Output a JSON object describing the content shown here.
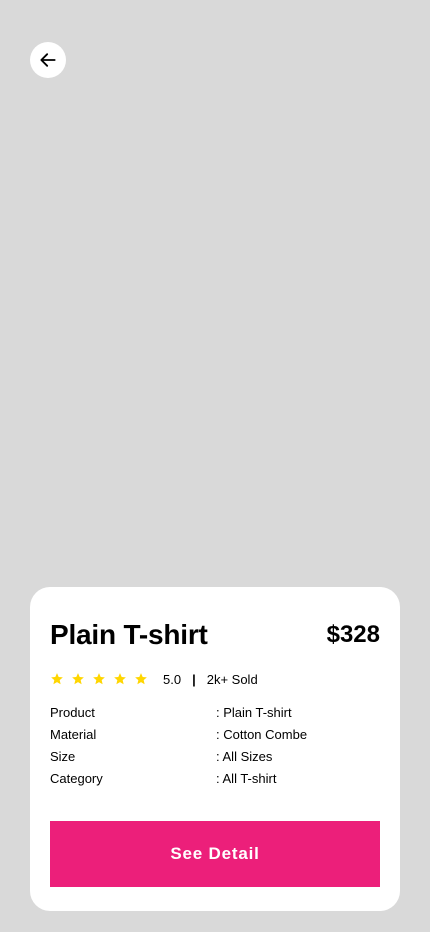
{
  "header": {
    "back_icon": "arrow-left-icon"
  },
  "product": {
    "title": "Plain T-shirt",
    "price": "$328",
    "rating": {
      "stars": 5,
      "star_color": "#FFD600",
      "value": "5.0",
      "separator": "|",
      "sold": "2k+ Sold"
    },
    "details": [
      {
        "label": "Product",
        "value": ": Plain T-shirt"
      },
      {
        "label": "Material",
        "value": ": Cotton Combe"
      },
      {
        "label": "Size",
        "value": ": All Sizes"
      },
      {
        "label": "Category",
        "value": ": All T-shirt"
      }
    ]
  },
  "actions": {
    "see_detail_label": "See Detail",
    "button_color": "#EC1F7A"
  }
}
